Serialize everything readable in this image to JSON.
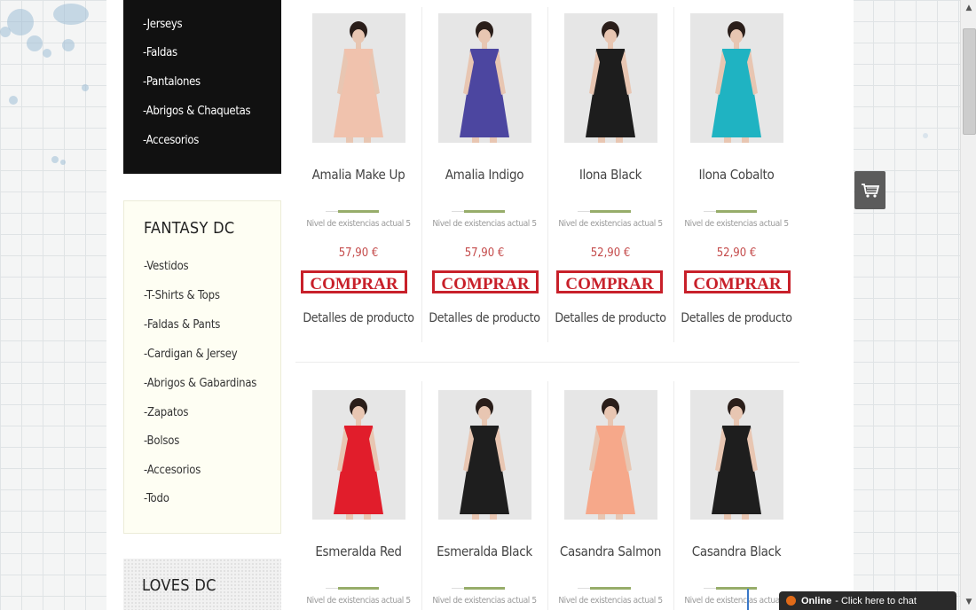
{
  "sidebar": {
    "categories_dark": [
      "-Jerseys",
      "-Faldas",
      "-Pantalones",
      "-Abrigos & Chaquetas",
      "-Accesorios"
    ],
    "fantasy": {
      "title": "FANTASY DC",
      "items": [
        "-Vestidos",
        "-T-Shirts & Tops",
        "-Faldas & Pants",
        "-Cardigan & Jersey",
        "-Abrigos & Gabardinas",
        "-Zapatos",
        "-Bolsos",
        "-Accesorios",
        "-Todo"
      ]
    },
    "loves": {
      "title": "LOVES DC"
    }
  },
  "products": [
    {
      "name": "Amalia Make Up",
      "stock": "Nivel de existencias actual 5",
      "price": "57,90 €",
      "buy": "COMPRAR",
      "details": "Detalles de producto",
      "dress_color": "#f0c2ad"
    },
    {
      "name": "Amalia Indigo",
      "stock": "Nivel de existencias actual 5",
      "price": "57,90 €",
      "buy": "COMPRAR",
      "details": "Detalles de producto",
      "dress_color": "#4c46a0"
    },
    {
      "name": "Ilona Black",
      "stock": "Nivel de existencias actual 5",
      "price": "52,90 €",
      "buy": "COMPRAR",
      "details": "Detalles de producto",
      "dress_color": "#1d1d1d"
    },
    {
      "name": "Ilona Cobalto",
      "stock": "Nivel de existencias actual 5",
      "price": "52,90 €",
      "buy": "COMPRAR",
      "details": "Detalles de producto",
      "dress_color": "#1fb3c2"
    },
    {
      "name": "Esmeralda Red",
      "stock": "Nivel de existencias actual 5",
      "price": "",
      "buy": "",
      "details": "",
      "dress_color": "#e11d2b"
    },
    {
      "name": "Esmeralda Black",
      "stock": "Nivel de existencias actual 5",
      "price": "",
      "buy": "",
      "details": "",
      "dress_color": "#1e1e1e"
    },
    {
      "name": "Casandra Salmon",
      "stock": "Nivel de existencias actual 5",
      "price": "",
      "buy": "",
      "details": "",
      "dress_color": "#f6a88a"
    },
    {
      "name": "Casandra Black",
      "stock": "Nivel de existencias actual 5",
      "price": "",
      "buy": "",
      "details": "",
      "dress_color": "#1e1e1e"
    }
  ],
  "chat": {
    "status": "Online",
    "text": "- Click here to chat"
  },
  "icons": {
    "cart": "shopping-cart-icon",
    "scroll_up": "arrow-up-icon",
    "scroll_down": "arrow-down-icon"
  },
  "colors": {
    "buy_border": "#c8202a",
    "price": "#c44a4a",
    "divider": "#97ad6a"
  }
}
